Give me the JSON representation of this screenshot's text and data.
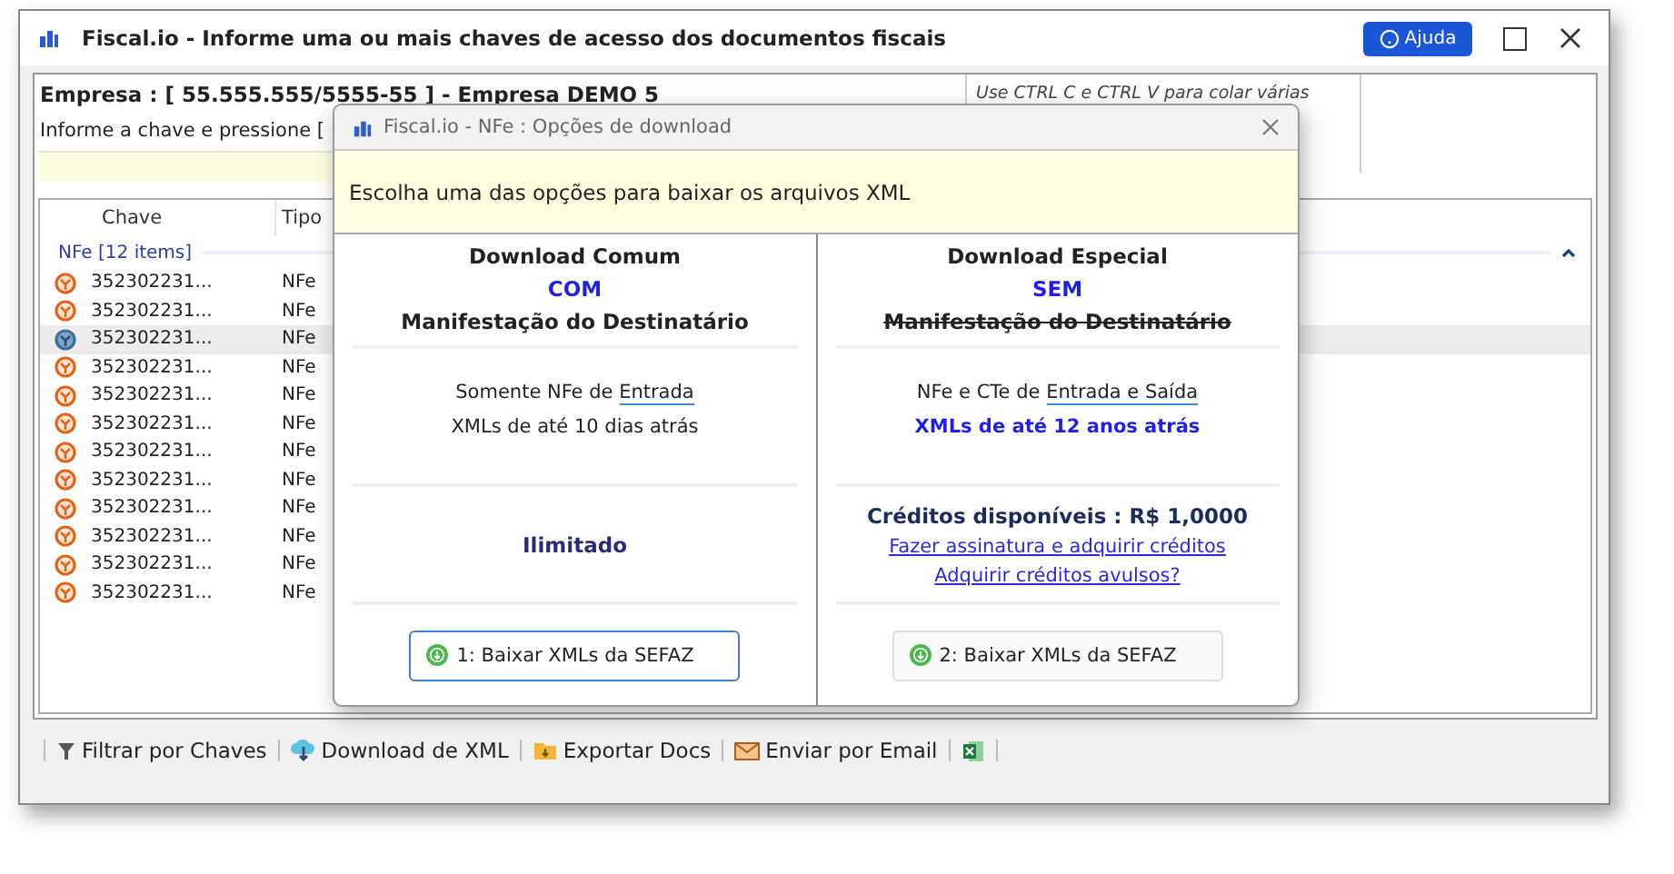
{
  "window": {
    "title": "Fiscal.io - Informe uma ou mais chaves de acesso dos documentos fiscais",
    "help_button": "Ajuda"
  },
  "header": {
    "company": "Empresa : [ 55.555.555/5555-55 ] - Empresa DEMO 5",
    "instruction": "Informe a chave e pressione [",
    "hint": "Use CTRL C e CTRL V para colar várias"
  },
  "grid": {
    "columns": [
      "Chave",
      "Tipo"
    ],
    "group": "NFe [12 items]",
    "rows": [
      {
        "key": "352302231...",
        "type": "NFe",
        "selected": false
      },
      {
        "key": "352302231...",
        "type": "NFe",
        "selected": false
      },
      {
        "key": "352302231...",
        "type": "NFe",
        "selected": true
      },
      {
        "key": "352302231...",
        "type": "NFe",
        "selected": false
      },
      {
        "key": "352302231...",
        "type": "NFe",
        "selected": false
      },
      {
        "key": "352302231...",
        "type": "NFe",
        "selected": false
      },
      {
        "key": "352302231...",
        "type": "NFe",
        "selected": false
      },
      {
        "key": "352302231...",
        "type": "NFe",
        "selected": false
      },
      {
        "key": "352302231...",
        "type": "NFe",
        "selected": false
      },
      {
        "key": "352302231...",
        "type": "NFe",
        "selected": false
      },
      {
        "key": "352302231...",
        "type": "NFe",
        "selected": false
      },
      {
        "key": "352302231...",
        "type": "NFe",
        "selected": false
      }
    ]
  },
  "toolbar": [
    {
      "kind": "filter",
      "label": "Filtrar por Chaves"
    },
    {
      "kind": "download",
      "label": "Download de XML"
    },
    {
      "kind": "export",
      "label": "Exportar Docs"
    },
    {
      "kind": "email",
      "label": "Enviar por Email"
    },
    {
      "kind": "excel"
    }
  ],
  "dialog": {
    "title": "Fiscal.io - NFe : Opções de download",
    "message": "Escolha uma das opções para baixar os arquivos XML",
    "options": [
      {
        "title": "Download Comum",
        "mode": "COM",
        "manifest": "Manifestação do Destinatário",
        "struck": false,
        "scope_prefix": "Somente NFe de ",
        "scope_term": "Entrada",
        "age": "XMLs de até 10 dias atrás",
        "age_highlight": false,
        "kind": "unlimited",
        "limit": "Ilimitado",
        "button": "1: Baixar XMLs da SEFAZ",
        "focused": true
      },
      {
        "title": "Download Especial",
        "mode": "SEM",
        "manifest": "Manifestação do Destinatário",
        "struck": true,
        "scope_prefix": "NFe e CTe de ",
        "scope_term": "Entrada e Saída",
        "age": "XMLs de até 12 anos atrás",
        "age_highlight": true,
        "kind": "credits",
        "credits": "Créditos disponíveis : R$  1,0000",
        "links": [
          "Fazer assinatura e adquirir créditos",
          "Adquirir créditos avulsos?"
        ],
        "button": "2: Baixar XMLs da SEFAZ",
        "focused": false
      }
    ]
  }
}
